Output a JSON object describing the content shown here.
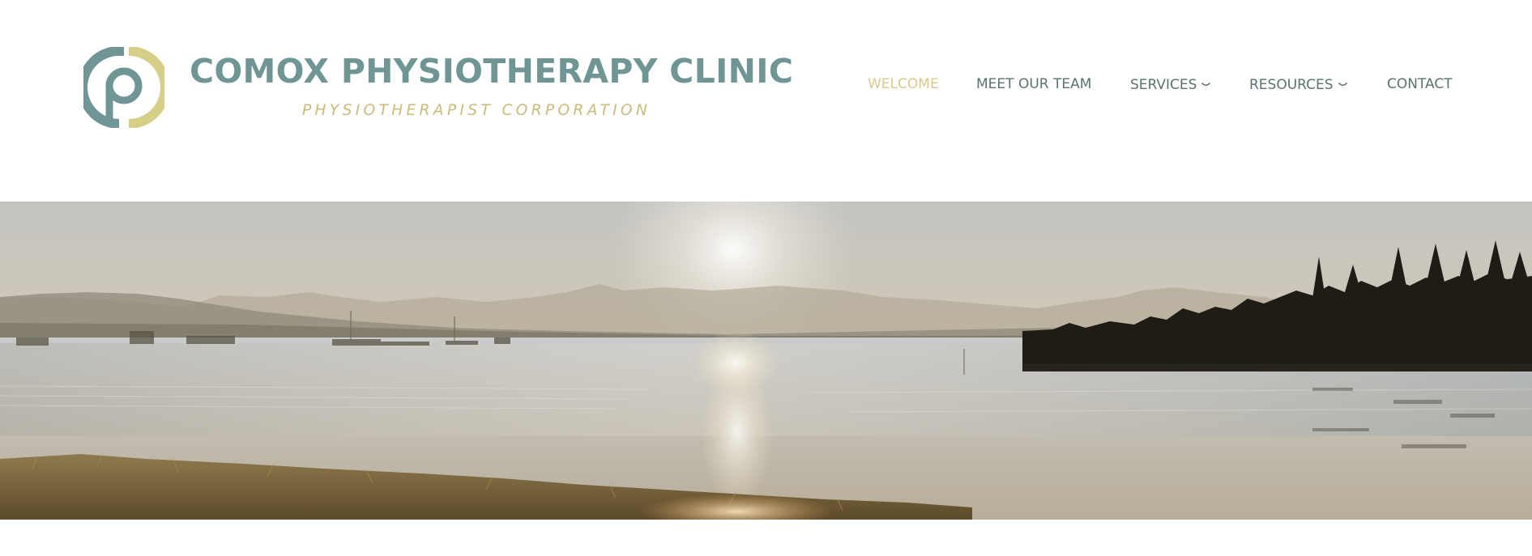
{
  "brand": {
    "title": "COMOX PHYSIOTHERAPY CLINIC",
    "subtitle": "PHYSIOTHERAPIST CORPORATION",
    "logo_icon": "cp-monogram-logo",
    "colors": {
      "teal": "#6f9594",
      "gold": "#cbbb7a"
    }
  },
  "nav": {
    "items": [
      {
        "label": "WELCOME",
        "active": true
      },
      {
        "label": "MEET OUR TEAM",
        "active": false
      },
      {
        "label": "SERVICES",
        "active": false,
        "icon": "chevron-down-icon"
      },
      {
        "label": "RESOURCES",
        "active": false,
        "icon": "chevron-down-icon"
      },
      {
        "label": "CONTACT",
        "active": false
      }
    ],
    "colors": {
      "default": "#5b7370",
      "active": "#d8c98a"
    }
  },
  "hero": {
    "image": "sunset-over-lake-with-mountains"
  }
}
